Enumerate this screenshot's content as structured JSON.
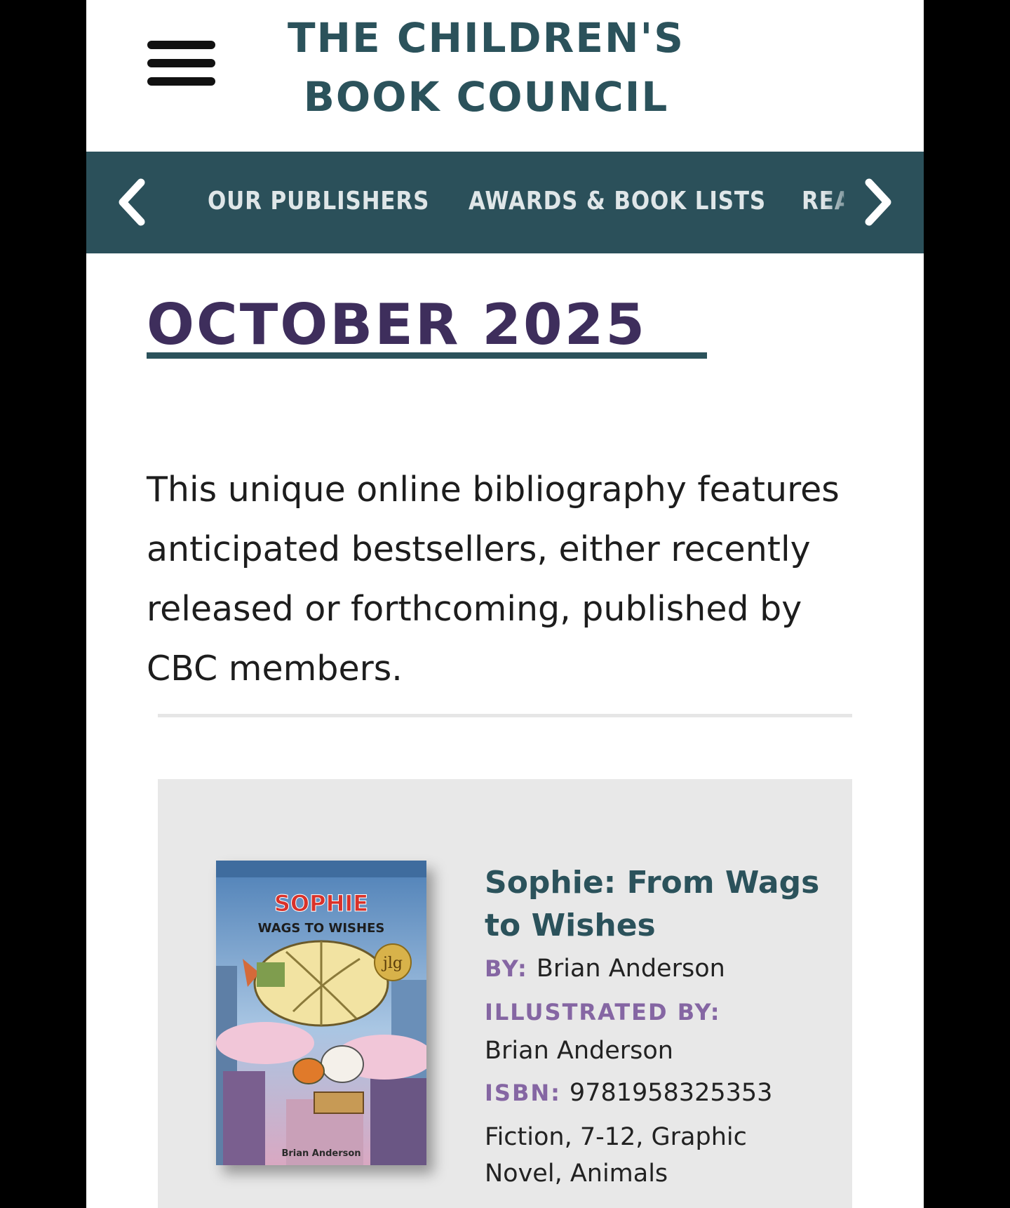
{
  "header": {
    "title_line1": "THE CHILDREN'S",
    "title_line2": "BOOK COUNCIL",
    "menu_icon": "hamburger-menu-icon"
  },
  "nav": {
    "prev_icon": "chevron-left-icon",
    "next_icon": "chevron-right-icon",
    "items": [
      {
        "label": "OUR PUBLISHERS"
      },
      {
        "label": "AWARDS & BOOK LISTS"
      },
      {
        "label": "REA"
      }
    ]
  },
  "main": {
    "heading": "OCTOBER 2025",
    "intro_lines": [
      "This unique online bibliography features",
      "anticipated bestsellers, either recently",
      "released or forthcoming, published by",
      "CBC members."
    ]
  },
  "book": {
    "title_line1": "Sophie: From Wags",
    "title_line2": "to Wishes",
    "by_label": "BY:",
    "author": "Brian Anderson",
    "illustrated_label": "ILLUSTRATED BY:",
    "illustrator": "Brian Anderson",
    "isbn_label": "ISBN:",
    "isbn": "9781958325353",
    "genres_line1": "Fiction, 7-12, Graphic",
    "genres_line2": "Novel, Animals",
    "cover": {
      "title": "SOPHIE",
      "subtitle": "WAGS TO WISHES",
      "badge": "jlg",
      "author": "Brian Anderson"
    }
  },
  "colors": {
    "teal": "#2b525b",
    "nav_bg": "#2b505a",
    "purple_heading": "#3e2e5c",
    "label_purple": "#8566a3",
    "card_bg": "#e8e8e8"
  }
}
